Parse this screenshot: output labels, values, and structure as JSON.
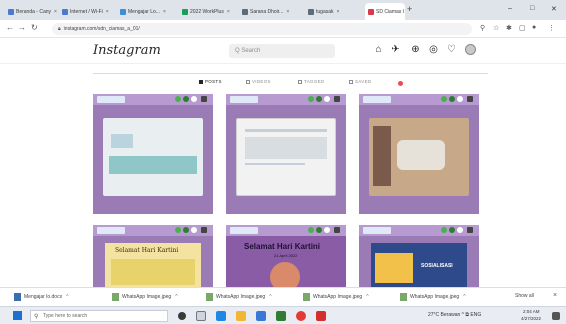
{
  "browser": {
    "tabs": [
      {
        "label": "Beranda - Cany",
        "color": "#4a7bd0"
      },
      {
        "label": "Internet / Wi-Fi",
        "color": "#4a7bd0"
      },
      {
        "label": "Mengajar Lo...",
        "color": "#3b8fd6"
      },
      {
        "label": "2022 WorkPlus",
        "color": "#1b9e57"
      },
      {
        "label": "Sarana Dhoir...",
        "color": "#5a6b7a"
      },
      {
        "label": "tugasak",
        "color": "#5a6b7a"
      },
      {
        "label": "SD Ciamas I",
        "color": "#d93b4a"
      }
    ],
    "new_tab": "+",
    "window_controls": [
      "–",
      "□",
      "✕"
    ],
    "address": "instagram.com/sdn_ciamas_a_01/"
  },
  "instagram": {
    "logo": "Instagram",
    "search_placeholder": "Q Search",
    "tabs": [
      "POSTS",
      "VIDEOS",
      "TAGGED",
      "SAVED"
    ],
    "posts": [
      {
        "title": "",
        "photo_colors": [
          "#e9eef1",
          "#8fc7c9"
        ]
      },
      {
        "title": "",
        "photo_colors": [
          "#f2f2f2",
          "#d8dde2"
        ]
      },
      {
        "title": "",
        "photo_colors": [
          "#c7a98a",
          "#e6e2da"
        ]
      },
      {
        "title": "Selamat Hari Kartini",
        "photo_colors": [
          "#f3e2a0",
          "#e8d26a"
        ]
      },
      {
        "title": "Selamat Hari Kartini",
        "subtitle": "21 April 2022",
        "photo_colors": [
          "#8a5ca5",
          "#d98a6a"
        ]
      },
      {
        "title": "SOSIALISASI",
        "photo_colors": [
          "#2f4a8a",
          "#f2c14a"
        ]
      }
    ]
  },
  "downloads": {
    "items": [
      "Mengajar lo.docx",
      "WhatsApp Image.jpeg",
      "WhatsApp Image.jpeg",
      "WhatsApp Image.jpeg",
      "WhatsApp Image.jpeg"
    ],
    "show_all": "Show all"
  },
  "taskbar": {
    "search_placeholder": "Type here to search",
    "tray_text": "27°C  Berawan  ^  ⧉  ENG",
    "clock_time": "2:04 AM",
    "clock_date": "4/27/2022"
  }
}
